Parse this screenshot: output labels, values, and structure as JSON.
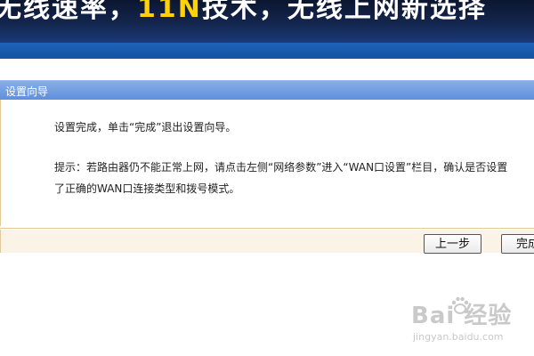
{
  "banner": {
    "text_before": "无线速率，",
    "text_highlight": "11N",
    "text_after": "技术，无线上网新选择"
  },
  "wizard": {
    "title": "设置向导",
    "message_complete": "设置完成，单击“完成”退出设置向导。",
    "message_hint": "提示：若路由器仍不能正常上网，请点击左侧“网络参数”进入“WAN口设置”栏目，确认是否设置了正确的WAN口连接类型和拨号模式。",
    "back_label": "上一步",
    "finish_label": "完成"
  },
  "watermark": {
    "brand": "Bai 经验",
    "url": "jingyan.baidu.com",
    "icon": "baidu-paw-icon"
  },
  "colors": {
    "banner_dark": "#0b1630",
    "banner_stripe": "#1e63b8",
    "header": "#6f9be0",
    "border": "#e1c99a",
    "footer": "#fbf4e6",
    "highlight": "#ffd200"
  }
}
